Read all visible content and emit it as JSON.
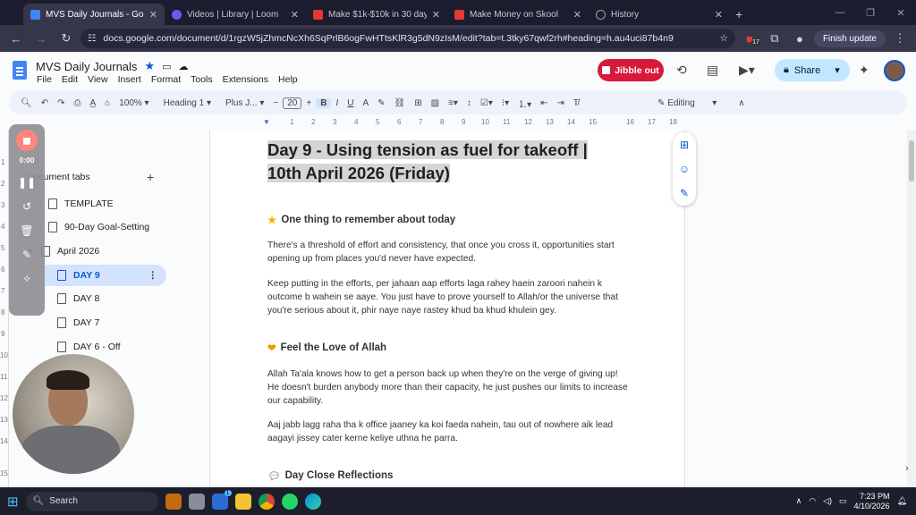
{
  "browser": {
    "tabs": [
      {
        "title": "MVS Daily Journals - Google Do",
        "color": "#4285f4",
        "active": true
      },
      {
        "title": "Videos | Library | Loom",
        "color": "#625df5",
        "active": false
      },
      {
        "title": "Make $1k-$10k in 30 days",
        "color": "#e53935",
        "active": false
      },
      {
        "title": "Make Money on Skool",
        "color": "#e53935",
        "active": false
      },
      {
        "title": "History",
        "color": "#9aa0a6",
        "active": false
      }
    ],
    "url": "docs.google.com/document/d/1rgzW5jZhmcNcXh6SqPrlB6ogFwHTtsKlR3g5dN9zIsM/edit?tab=t.3tky67qwf2rh#heading=h.au4uci87b4n9",
    "finish_update": "Finish update",
    "ext_badge": "17"
  },
  "doc": {
    "title": "MVS Daily Journals",
    "menus": [
      "File",
      "Edit",
      "View",
      "Insert",
      "Format",
      "Tools",
      "Extensions",
      "Help"
    ],
    "jibble_label": "Jibble out",
    "share_label": "Share"
  },
  "toolbar": {
    "zoom": "100%",
    "style": "Heading 1",
    "font": "Plus J...",
    "size": "20",
    "mode": "Editing"
  },
  "ruler": [
    "1",
    "2",
    "3",
    "4",
    "5",
    "6",
    "7",
    "8",
    "9",
    "10",
    "11",
    "12",
    "13",
    "14",
    "15",
    "16",
    "17",
    "18"
  ],
  "vruler": [
    "1",
    "2",
    "3",
    "4",
    "5",
    "6",
    "7",
    "8",
    "9",
    "10",
    "11",
    "12",
    "13",
    "14",
    "15"
  ],
  "sidebar": {
    "header": "Document tabs",
    "items": [
      {
        "label": "TEMPLATE"
      },
      {
        "label": "90-Day Goal-Setting"
      },
      {
        "label": "April 2026"
      },
      {
        "label": "DAY 9"
      },
      {
        "label": "DAY 8"
      },
      {
        "label": "DAY 7"
      },
      {
        "label": "DAY 6 - Off"
      }
    ]
  },
  "recorder": {
    "time": "0:00"
  },
  "content": {
    "title": "Day 9 - Using tension as fuel for takeoff | 10th April 2026 (Friday)",
    "h2_1": "One thing to remember about today",
    "p1": "There's a threshold of effort and consistency, that once you cross it, opportunities start opening up from places you'd never have expected.",
    "p2": "Keep putting in the efforts, per jahaan aap efforts laga rahey haein zaroori nahein k outcome b wahein se aaye. You just have to prove yourself to Allah/or the universe that you're serious about it, phir naye naye rastey khud ba khud khulein gey.",
    "h2_2": "Feel the Love of Allah",
    "p3": "Allah Ta'ala knows how to get a person back up when they're on the verge of giving up! He doesn't burden anybody more than their capacity, he just pushes our limits to increase our capability.",
    "p4": "Aaj jabb lagg raha tha k office jaaney ka koi faeda nahein, tau out of nowhere aik lead aagayi jissey cater kerne keliye uthna he parra.",
    "h2_3": "Day Close Reflections"
  },
  "taskbar": {
    "search": "Search",
    "time": "7:23 PM",
    "date": "4/10/2026",
    "notif_badge": "1"
  }
}
